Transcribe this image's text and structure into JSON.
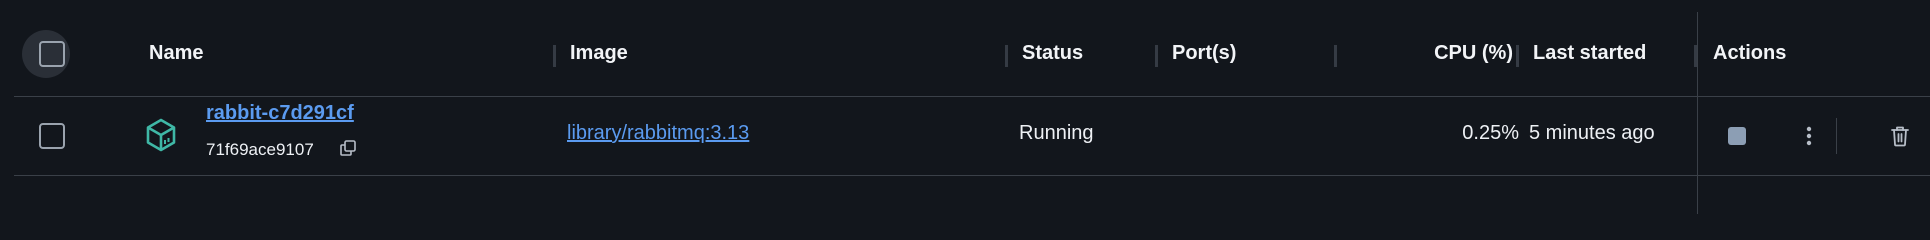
{
  "header": {
    "name": "Name",
    "image": "Image",
    "status": "Status",
    "ports": "Port(s)",
    "cpu": "CPU (%)",
    "last_started": "Last started",
    "actions": "Actions"
  },
  "rows": [
    {
      "name": "rabbit-c7d291cf",
      "container_id": "71f69ace9107",
      "image": "library/rabbitmq:3.13",
      "status": "Running",
      "ports": "",
      "cpu": "0.25%",
      "last_started": "5 minutes ago"
    }
  ],
  "icons": {
    "container": "cube-icon",
    "copy": "copy-icon",
    "stop": "stop-icon",
    "more": "more-vertical-icon",
    "delete": "trash-icon"
  },
  "colors": {
    "background": "#12161c",
    "link": "#5b9bf0",
    "container_icon": "#3fb8a6",
    "stop_button": "#8c9eb4"
  }
}
